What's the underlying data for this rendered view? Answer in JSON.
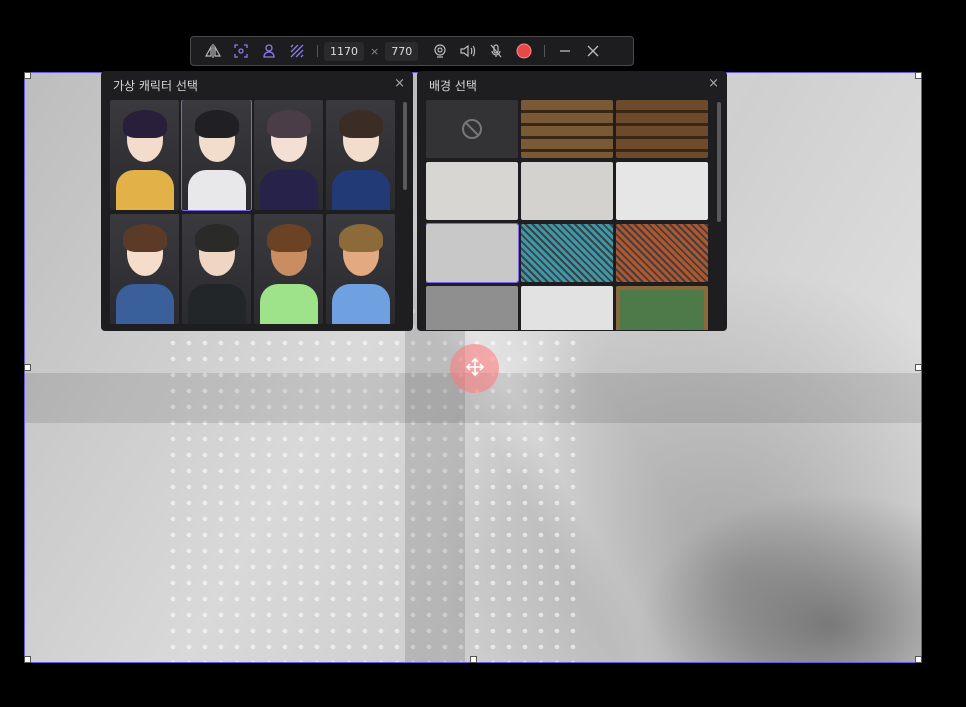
{
  "toolbar": {
    "width": "1170",
    "height": "770",
    "times": "×",
    "icons": [
      "mirror-icon",
      "focus-icon",
      "avatar-icon",
      "pattern-icon",
      "webcam-icon",
      "speaker-icon",
      "mic-muted-icon",
      "record-icon",
      "minimize-icon",
      "close-icon"
    ]
  },
  "character_panel": {
    "title": "가상 캐릭터 선택",
    "close": "×",
    "characters": [
      {
        "name": "purple-hair-girl",
        "hair": "#2a1f3a",
        "skin": "#f3dccc",
        "body": "#e2b248"
      },
      {
        "name": "black-hair-boy",
        "hair": "#1f1f24",
        "skin": "#f2dccb",
        "body": "#e8e8ea",
        "selected": true
      },
      {
        "name": "blue-ribbon-girl",
        "hair": "#4b3d48",
        "skin": "#f4dfd4",
        "body": "#27224a"
      },
      {
        "name": "suit-boy",
        "hair": "#3b2d25",
        "skin": "#f2dccb",
        "body": "#223a75"
      },
      {
        "name": "brown-hair-girl",
        "hair": "#5b3a28",
        "skin": "#f5dccb",
        "body": "#3a5f9a"
      },
      {
        "name": "green-jacket-boy",
        "hair": "#2a2a28",
        "skin": "#f0d6c2",
        "body": "#232629"
      },
      {
        "name": "3d-woman",
        "hair": "#6b4224",
        "skin": "#c98d62",
        "body": "#9ee28a"
      },
      {
        "name": "3d-man",
        "hair": "#8c6a3a",
        "skin": "#e3a980",
        "body": "#6fa1e0"
      }
    ]
  },
  "background_panel": {
    "title": "배경 선택",
    "close": "×",
    "backgrounds": [
      {
        "name": "none",
        "color": "#333336"
      },
      {
        "name": "bookshelf-1",
        "color": "#7a5a36"
      },
      {
        "name": "bookshelf-2",
        "color": "#6e4a2c"
      },
      {
        "name": "conference-room-1",
        "color": "#d8d6d2"
      },
      {
        "name": "conference-room-2",
        "color": "#d4d2ce"
      },
      {
        "name": "white-hallway",
        "color": "#e6e6e6"
      },
      {
        "name": "gray-shadow",
        "color": "#c8c8c8",
        "selected": true
      },
      {
        "name": "teal-texture",
        "color": "#3a9aab"
      },
      {
        "name": "orange-texture",
        "color": "#b3562b"
      },
      {
        "name": "office-shelf",
        "color": "#8f8f8f"
      },
      {
        "name": "white-shelf",
        "color": "#e2e2e2"
      },
      {
        "name": "chalkboard",
        "color": "#4e7a4a"
      }
    ]
  }
}
